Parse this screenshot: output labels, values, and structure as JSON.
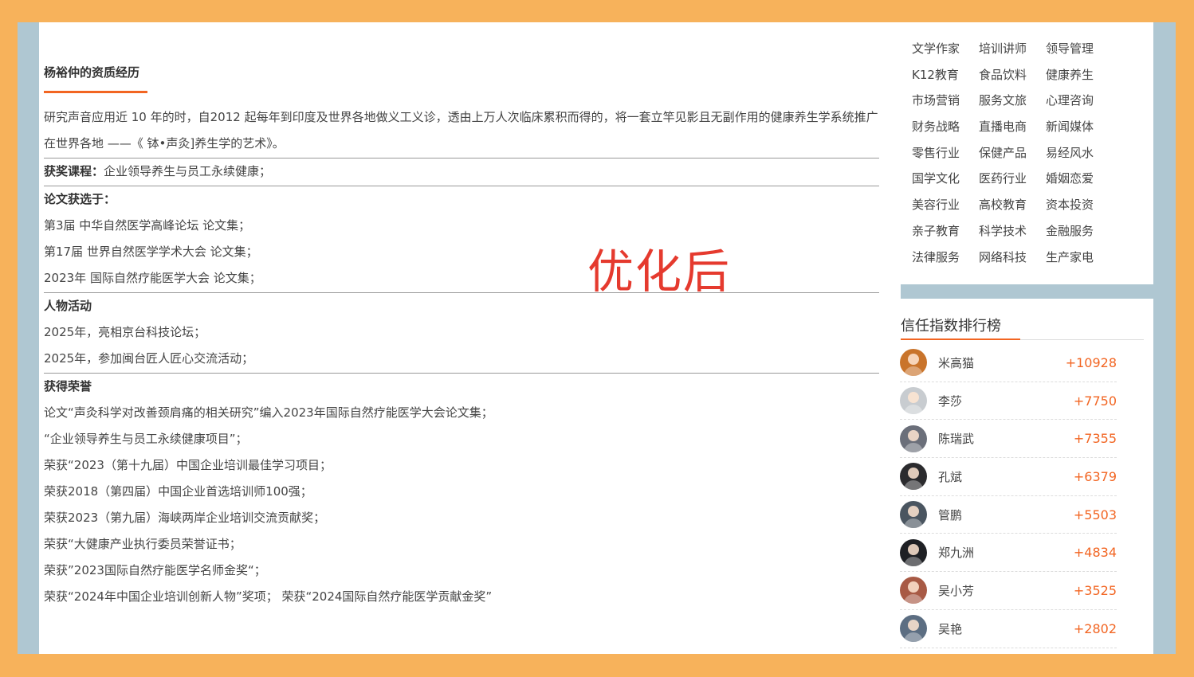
{
  "main": {
    "section_title": "杨裕仲的资质经历",
    "watermark": "优化后",
    "intro": "研究声音应用近 10 年的时，自2012 起每年到印度及世界各地做义工义诊，透由上万人次临床累积而得的，将一套立竿见影且无副作用的健康养生学系统推广在世界各地 ——《 钵•声灸]养生学的艺术》。",
    "award_label": "获奖课程：",
    "award_value": "企业领导养生与员工永续健康；",
    "papers_title": "论文获选于：",
    "papers": [
      "第3届 中华自然医学高峰论坛 论文集；",
      "第17届 世界自然医学学术大会 论文集；",
      "2023年 国际自然疗能医学大会 论文集；"
    ],
    "activities_title": "人物活动",
    "activities": [
      "2025年，亮相京台科技论坛；",
      "2025年，参加闽台匠人匠心交流活动；"
    ],
    "honors_title": "获得荣誉",
    "honors": [
      "论文“声灸科学对改善颈肩痛的相关研究”编入2023年国际自然疗能医学大会论文集；",
      "“企业领导养生与员工永续健康项目”；",
      "荣获“2023（第十九届）中国企业培训最佳学习项目；",
      "荣获2018（第四届）中国企业首选培训师100强；",
      "荣获2023（第九届）海峡两岸企业培训交流贡献奖；",
      "荣获“大健康产业执行委员荣誉证书；",
      "荣获”2023国际自然疗能医学名师金奖“；",
      "荣获“2024年中国企业培训创新人物”奖项； 荣获“2024国际自然疗能医学贡献金奖”"
    ]
  },
  "sidebar": {
    "tags": [
      [
        "文学作家",
        "培训讲师",
        "领导管理"
      ],
      [
        "K12教育",
        "食品饮料",
        "健康养生"
      ],
      [
        "市场营销",
        "服务文旅",
        "心理咨询"
      ],
      [
        "财务战略",
        "直播电商",
        "新闻媒体"
      ],
      [
        "零售行业",
        "保健产品",
        "易经风水"
      ],
      [
        "国学文化",
        "医药行业",
        "婚姻恋爱"
      ],
      [
        "美容行业",
        "高校教育",
        "资本投资"
      ],
      [
        "亲子教育",
        "科学技术",
        "金融服务"
      ],
      [
        "法律服务",
        "网络科技",
        "生产家电"
      ]
    ],
    "ranking_title": "信任指数排行榜",
    "ranking": [
      {
        "name": "米高猫",
        "score": "+10928",
        "avatar_color": "#C9742B"
      },
      {
        "name": "李莎",
        "score": "+7750",
        "avatar_color": "#C8CCD0"
      },
      {
        "name": "陈瑞武",
        "score": "+7355",
        "avatar_color": "#6B6F7A"
      },
      {
        "name": "孔斌",
        "score": "+6379",
        "avatar_color": "#2B2B2E"
      },
      {
        "name": "管鹏",
        "score": "+5503",
        "avatar_color": "#4A5560"
      },
      {
        "name": "郑九洲",
        "score": "+4834",
        "avatar_color": "#1E2024"
      },
      {
        "name": "吴小芳",
        "score": "+3525",
        "avatar_color": "#A85A45"
      },
      {
        "name": "吴艳",
        "score": "+2802",
        "avatar_color": "#5C6E82"
      }
    ]
  }
}
